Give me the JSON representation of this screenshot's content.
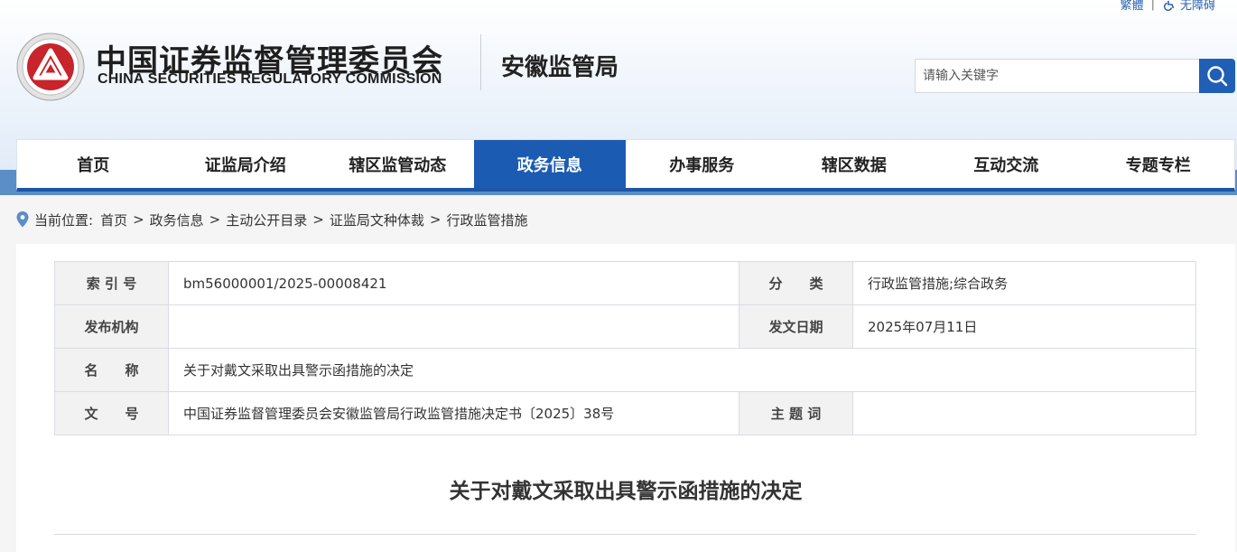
{
  "top_links": {
    "traditional": "繁體",
    "accessibility": "无障碍"
  },
  "header": {
    "cn_title": "中国证券监督管理委员会",
    "en_title": "CHINA SECURITIES REGULATORY COMMISSION",
    "bureau": "安徽监管局"
  },
  "search": {
    "placeholder": "请输入关键字"
  },
  "nav": {
    "items": [
      {
        "label": "首页"
      },
      {
        "label": "证监局介绍"
      },
      {
        "label": "辖区监管动态"
      },
      {
        "label": "政务信息"
      },
      {
        "label": "办事服务"
      },
      {
        "label": "辖区数据"
      },
      {
        "label": "互动交流"
      },
      {
        "label": "专题专栏"
      }
    ],
    "active": "政务信息"
  },
  "breadcrumb": {
    "prefix": "当前位置:",
    "items": [
      "首页",
      "政务信息",
      "主动公开目录",
      "证监局文种体裁",
      "行政监管措施"
    ]
  },
  "meta": {
    "index_label": "索 引 号",
    "index_value": "bm56000001/2025-00008421",
    "category_label": "分　　类",
    "category_value": "行政监管措施;综合政务",
    "publisher_label": "发布机构",
    "publisher_value": "",
    "date_label": "发文日期",
    "date_value": "2025年07月11日",
    "name_label": "名　　称",
    "name_value": "关于对戴文采取出具警示函措施的决定",
    "docno_label": "文　　号",
    "docno_value": "中国证券监督管理委员会安徽监管局行政监管措施决定书〔2025〕38号",
    "keywords_label": "主 题 词",
    "keywords_value": ""
  },
  "document": {
    "title": "关于对戴文采取出具警示函措施的决定"
  },
  "colors": {
    "primary": "#1c5bb2",
    "band": "#5b8ec7",
    "logo_red": "#c8242b"
  }
}
